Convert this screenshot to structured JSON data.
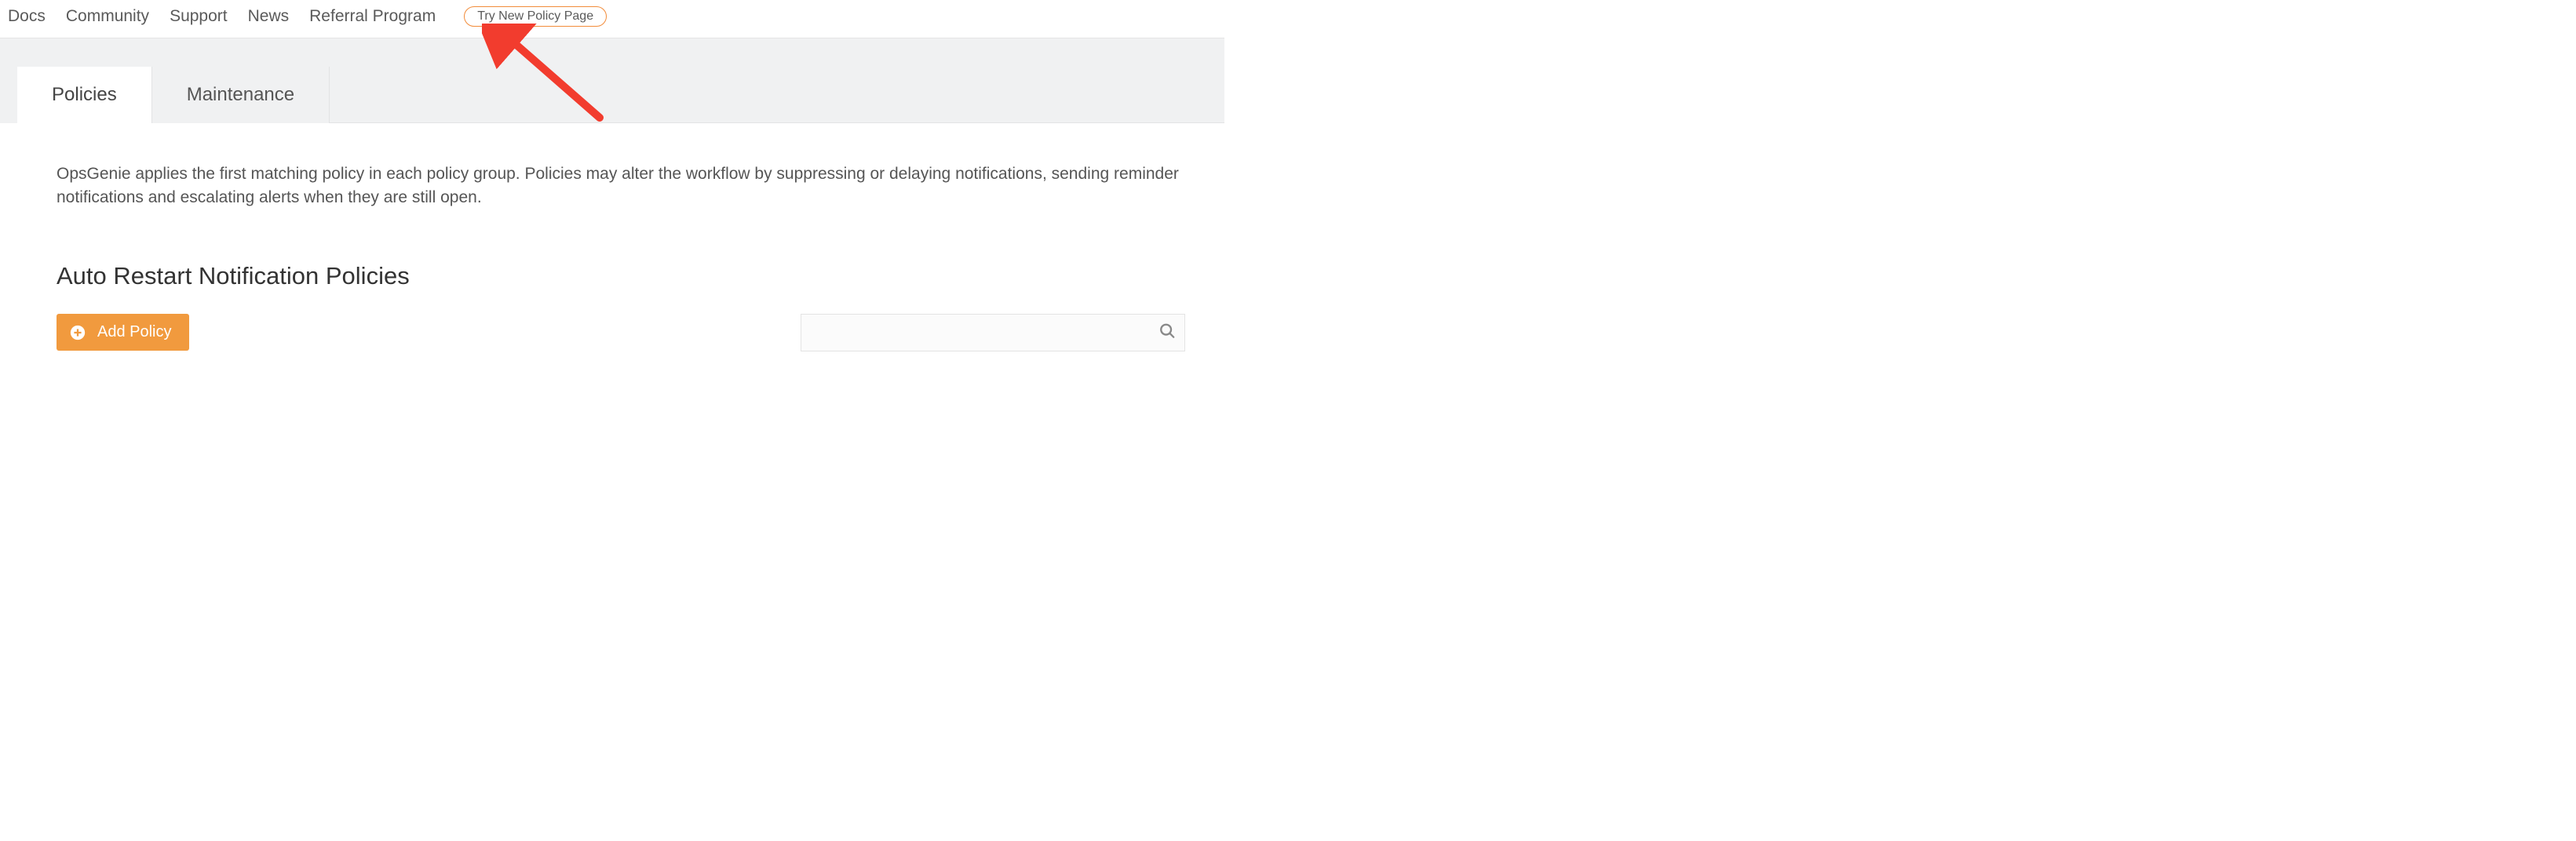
{
  "nav": {
    "items": [
      "Docs",
      "Community",
      "Support",
      "News",
      "Referral Program"
    ],
    "try_new": "Try New Policy Page"
  },
  "tabs": {
    "policies": "Policies",
    "maintenance": "Maintenance"
  },
  "main": {
    "description": "OpsGenie applies the first matching policy in each policy group. Policies may alter the workflow by suppressing or delaying notifications, sending reminder notifications and escalating alerts when they are still open.",
    "section_title": "Auto Restart Notification Policies",
    "add_button": "Add Policy",
    "search_placeholder": ""
  },
  "colors": {
    "accent": "#f19a3e",
    "arrow": "#f23c2e"
  }
}
